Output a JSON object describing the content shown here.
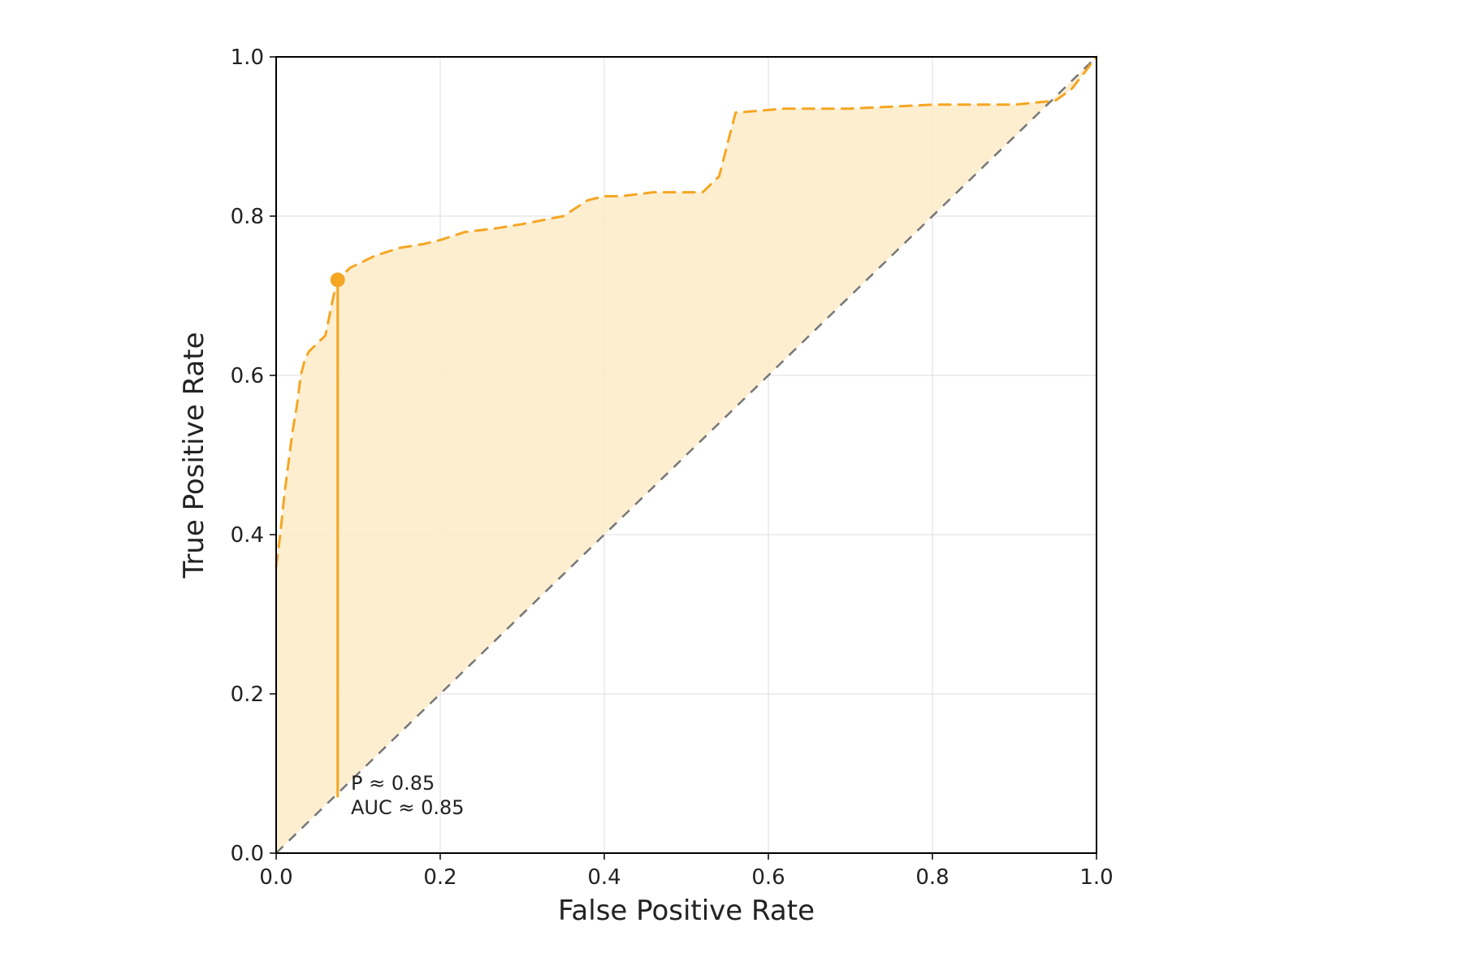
{
  "chart_data": {
    "type": "line",
    "title": "",
    "xlabel": "False Positive Rate",
    "ylabel": "True Positive Rate",
    "xlim": [
      0.0,
      1.0
    ],
    "ylim": [
      0.0,
      1.0
    ],
    "x_ticks": [
      "0.0",
      "0.2",
      "0.4",
      "0.6",
      "0.8",
      "1.0"
    ],
    "y_ticks": [
      "0.0",
      "0.2",
      "0.4",
      "0.6",
      "0.8",
      "1.0"
    ],
    "series": [
      {
        "name": "ROC curve",
        "color": "#f5a623",
        "dash": true,
        "x": [
          0.0,
          0.005,
          0.01,
          0.015,
          0.02,
          0.025,
          0.03,
          0.035,
          0.04,
          0.05,
          0.06,
          0.07,
          0.075,
          0.08,
          0.085,
          0.09,
          0.12,
          0.15,
          0.18,
          0.2,
          0.23,
          0.27,
          0.3,
          0.35,
          0.38,
          0.4,
          0.42,
          0.46,
          0.52,
          0.54,
          0.56,
          0.62,
          0.7,
          0.8,
          0.9,
          0.95,
          0.97,
          1.0
        ],
        "y": [
          0.36,
          0.4,
          0.45,
          0.49,
          0.53,
          0.56,
          0.6,
          0.62,
          0.63,
          0.64,
          0.65,
          0.7,
          0.72,
          0.72,
          0.73,
          0.735,
          0.75,
          0.76,
          0.765,
          0.77,
          0.78,
          0.785,
          0.79,
          0.8,
          0.82,
          0.825,
          0.825,
          0.83,
          0.83,
          0.85,
          0.93,
          0.935,
          0.935,
          0.94,
          0.94,
          0.945,
          0.96,
          1.0
        ]
      },
      {
        "name": "Diagonal (chance)",
        "color": "#777777",
        "dash": true,
        "x": [
          0.0,
          1.0
        ],
        "y": [
          0.0,
          1.0
        ]
      }
    ],
    "marker": {
      "x": 0.075,
      "y": 0.72
    },
    "marker_vline": {
      "x": 0.075,
      "y0": 0.07,
      "y1": 0.72
    },
    "annotations": [
      {
        "key": "p_text",
        "text": "P ≈ 0.85",
        "x": 0.09,
        "y": 0.085
      },
      {
        "key": "auc_text",
        "text": "AUC ≈ 0.85",
        "x": 0.09,
        "y": 0.055
      }
    ],
    "grid": true,
    "fill_between": {
      "upper": "ROC curve",
      "lower": "Diagonal (chance)",
      "color": "#fdebc8"
    }
  },
  "labels": {
    "xlabel": "False Positive Rate",
    "ylabel": "True Positive Rate",
    "p_text": "P ≈ 0.85",
    "auc_text": "AUC ≈ 0.85"
  },
  "ticks": {
    "x": [
      "0.0",
      "0.2",
      "0.4",
      "0.6",
      "0.8",
      "1.0"
    ],
    "y": [
      "0.0",
      "0.2",
      "0.4",
      "0.6",
      "0.8",
      "1.0"
    ]
  }
}
